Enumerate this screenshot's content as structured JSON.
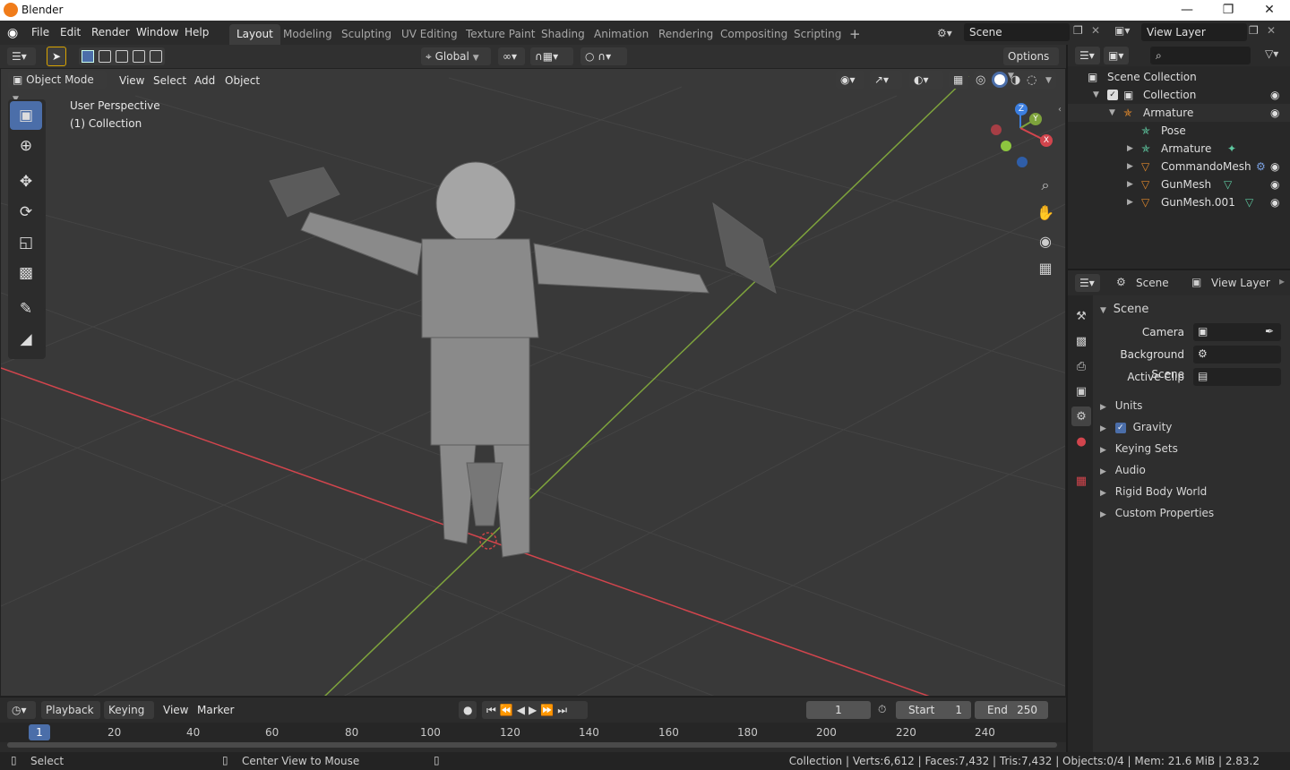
{
  "window": {
    "title": "Blender"
  },
  "menus": [
    "File",
    "Edit",
    "Render",
    "Window",
    "Help"
  ],
  "workspaces": [
    "Layout",
    "Modeling",
    "Sculpting",
    "UV Editing",
    "Texture Paint",
    "Shading",
    "Animation",
    "Rendering",
    "Compositing",
    "Scripting"
  ],
  "active_workspace": "Layout",
  "scene_selector": "Scene",
  "view_layer_selector": "View Layer",
  "toolbar": {
    "orientation": "Global",
    "options_label": "Options"
  },
  "viewport": {
    "mode": "Object Mode",
    "menus": [
      "View",
      "Select",
      "Add",
      "Object"
    ],
    "overlay_title": "User Perspective",
    "overlay_collection": "(1) Collection",
    "gizmo_axes": {
      "z": "Z",
      "y": "Y",
      "x": "X"
    }
  },
  "outliner": {
    "items": [
      {
        "label": "Scene Collection",
        "icon": "collection-icon"
      },
      {
        "label": "Collection",
        "icon": "collection-icon"
      },
      {
        "label": "Armature",
        "icon": "armature-icon"
      },
      {
        "label": "Pose",
        "icon": "pose-icon"
      },
      {
        "label": "Armature",
        "icon": "armature-data-icon"
      },
      {
        "label": "CommandoMesh",
        "icon": "mesh-icon"
      },
      {
        "label": "GunMesh",
        "icon": "mesh-icon"
      },
      {
        "label": "GunMesh.001",
        "icon": "mesh-icon"
      }
    ]
  },
  "properties": {
    "tab_scene": "Scene",
    "tab_view_layer": "View Layer",
    "panel_title": "Scene",
    "camera_label": "Camera",
    "background_scene_label": "Background Scene",
    "active_clip_label": "Active Clip",
    "subpanels": [
      "Units",
      "Gravity",
      "Keying Sets",
      "Audio",
      "Rigid Body World",
      "Custom Properties"
    ],
    "gravity_enabled": true
  },
  "timeline": {
    "menus": [
      "Playback",
      "Keying",
      "View",
      "Marker"
    ],
    "current_frame": "1",
    "start_label": "Start",
    "start_value": "1",
    "end_label": "End",
    "end_value": "250",
    "ticks": [
      "20",
      "40",
      "60",
      "80",
      "100",
      "120",
      "140",
      "160",
      "180",
      "200",
      "220",
      "240"
    ],
    "playhead_label": "1"
  },
  "statusbar": {
    "select": "Select",
    "center_view": "Center View to Mouse",
    "stats": "Collection | Verts:6,612 | Faces:7,432 | Tris:7,432 | Objects:0/4 | Mem: 21.6 MiB | 2.83.2"
  },
  "colors": {
    "accent": "#4b6ea9",
    "x_axis": "#d2454d",
    "y_axis": "#7ea33c",
    "z_axis": "#3b7ee0",
    "mesh_icon": "#e0882c"
  }
}
